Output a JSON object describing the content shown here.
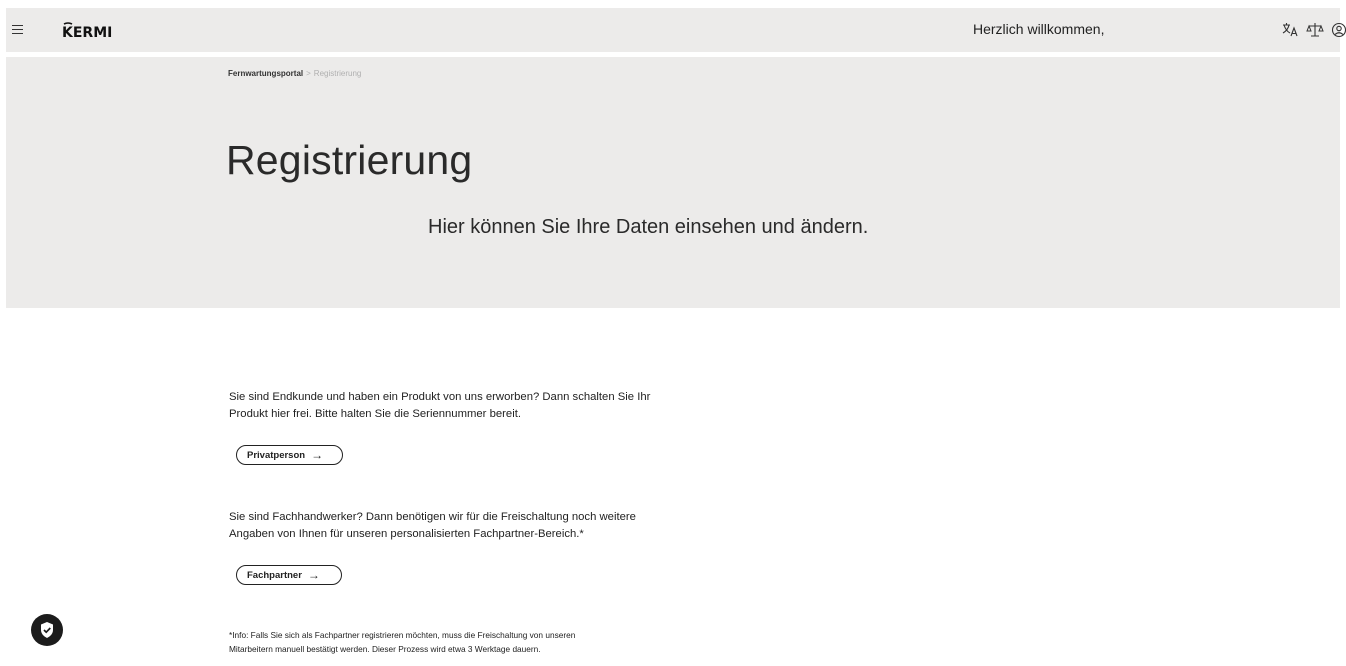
{
  "header": {
    "brand": "KERMI",
    "welcome": "Herzlich willkommen,",
    "icons": [
      "menu-icon",
      "translate-icon",
      "legal-scale-icon",
      "user-account-icon"
    ]
  },
  "breadcrumb": {
    "root": "Fernwartungsportal",
    "separator": ">",
    "current": "Registrierung"
  },
  "hero": {
    "title": "Registrierung",
    "subtitle": "Hier können Sie Ihre Daten einsehen und ändern."
  },
  "private": {
    "text_line1": "Sie sind Endkunde und haben ein Produkt von uns erworben? Dann schalten Sie Ihr",
    "text_line2": "Produkt hier frei. Bitte halten Sie die Seriennummer bereit.",
    "button": "Privatperson",
    "arrow": "→"
  },
  "partner": {
    "text_line1": "Sie sind Fachhandwerker? Dann benötigen wir für die Freischaltung noch weitere",
    "text_line2": "Angaben von Ihnen für unseren personalisierten Fachpartner-Bereich.*",
    "button": "Fachpartner",
    "arrow": "→"
  },
  "info": {
    "line1": "*Info: Falls Sie sich als Fachpartner registrieren möchten, muss die Freischaltung von unseren",
    "line2": "Mitarbeitern manuell bestätigt werden. Dieser Prozess wird etwa 3 Werktage dauern."
  },
  "colors": {
    "header_bg": "#ecebea",
    "text": "#1a1a1a",
    "muted": "#b0b0b0",
    "privacy_badge": "#1c1c1c"
  }
}
